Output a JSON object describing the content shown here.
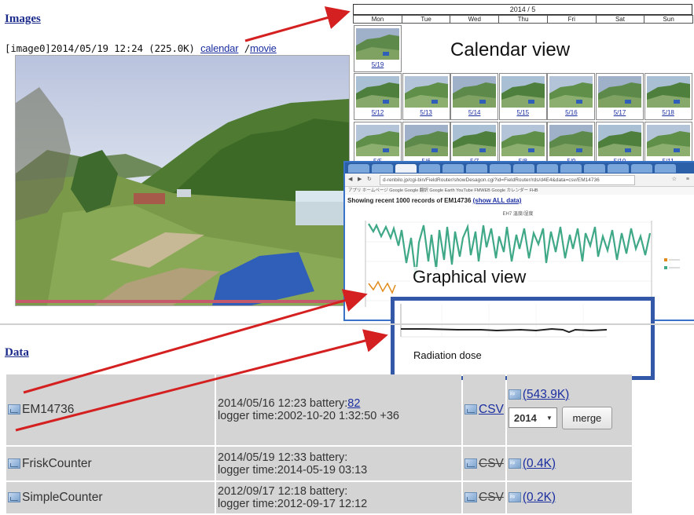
{
  "images": {
    "heading": "Images",
    "caption_prefix": "[image0]2014/05/19 12:24 (225.0K)",
    "calendar_link": "calendar",
    "separator": "/",
    "movie_link": "movie"
  },
  "calendar": {
    "month_title": "2014 / 5",
    "days": [
      "Mon",
      "Tue",
      "Wed",
      "Thu",
      "Fri",
      "Sat",
      "Sun"
    ],
    "week1": [
      "5/19"
    ],
    "week2": [
      "5/12",
      "5/13",
      "5/14",
      "5/15",
      "5/16",
      "5/17",
      "5/18"
    ],
    "week3": [
      "5/5",
      "5/6",
      "5/7",
      "5/8",
      "5/9",
      "5/10",
      "5/11"
    ],
    "label": "Calendar view"
  },
  "graph": {
    "url": "d-renbilo.jp/cgi-bin/FieldRouter/showDesagon.cgi?id=FieldRouter/rds/d4E4&data=csv/EM14736",
    "bookmarks": "アプリ  ホームページ  Google  Google 翻訳  Google Earth  YouTube  FMWEB  Google カレンダー  FHB",
    "records_text": "Showing recent 1000 records of EM14736",
    "show_all": "(show ALL data)",
    "chart_title": "EH7 温度/湿度",
    "label": "Graphical  view"
  },
  "radiation": {
    "label": "Radiation dose"
  },
  "data": {
    "heading": "Data",
    "rows": [
      {
        "name": "EM14736",
        "info_line1": "2014/05/16 12:23 battery:",
        "battery": "82",
        "info_line2": "logger time:2002-10-20 1:32:50 +36",
        "csv": "CSV",
        "size": "(543.9K)",
        "year": "2014",
        "merge": "merge"
      },
      {
        "name": "FriskCounter",
        "info_line1": "2014/05/19 12:33 battery:",
        "info_line2": "logger time:2014-05-19 03:13",
        "csv": "CSV",
        "size": "(0.4K)"
      },
      {
        "name": "SimpleCounter",
        "info_line1": "2012/09/17 12:18 battery:",
        "info_line2": "logger time:2012-09-17 12:12",
        "csv": "CSV",
        "size": "(0.2K)"
      }
    ]
  },
  "colors": {
    "link": "#1a2ea0",
    "highlight_box": "#3358a8",
    "arrow": "#d42020",
    "series_humidity": "#3fa886",
    "series_temperature": "#e08a1a"
  }
}
